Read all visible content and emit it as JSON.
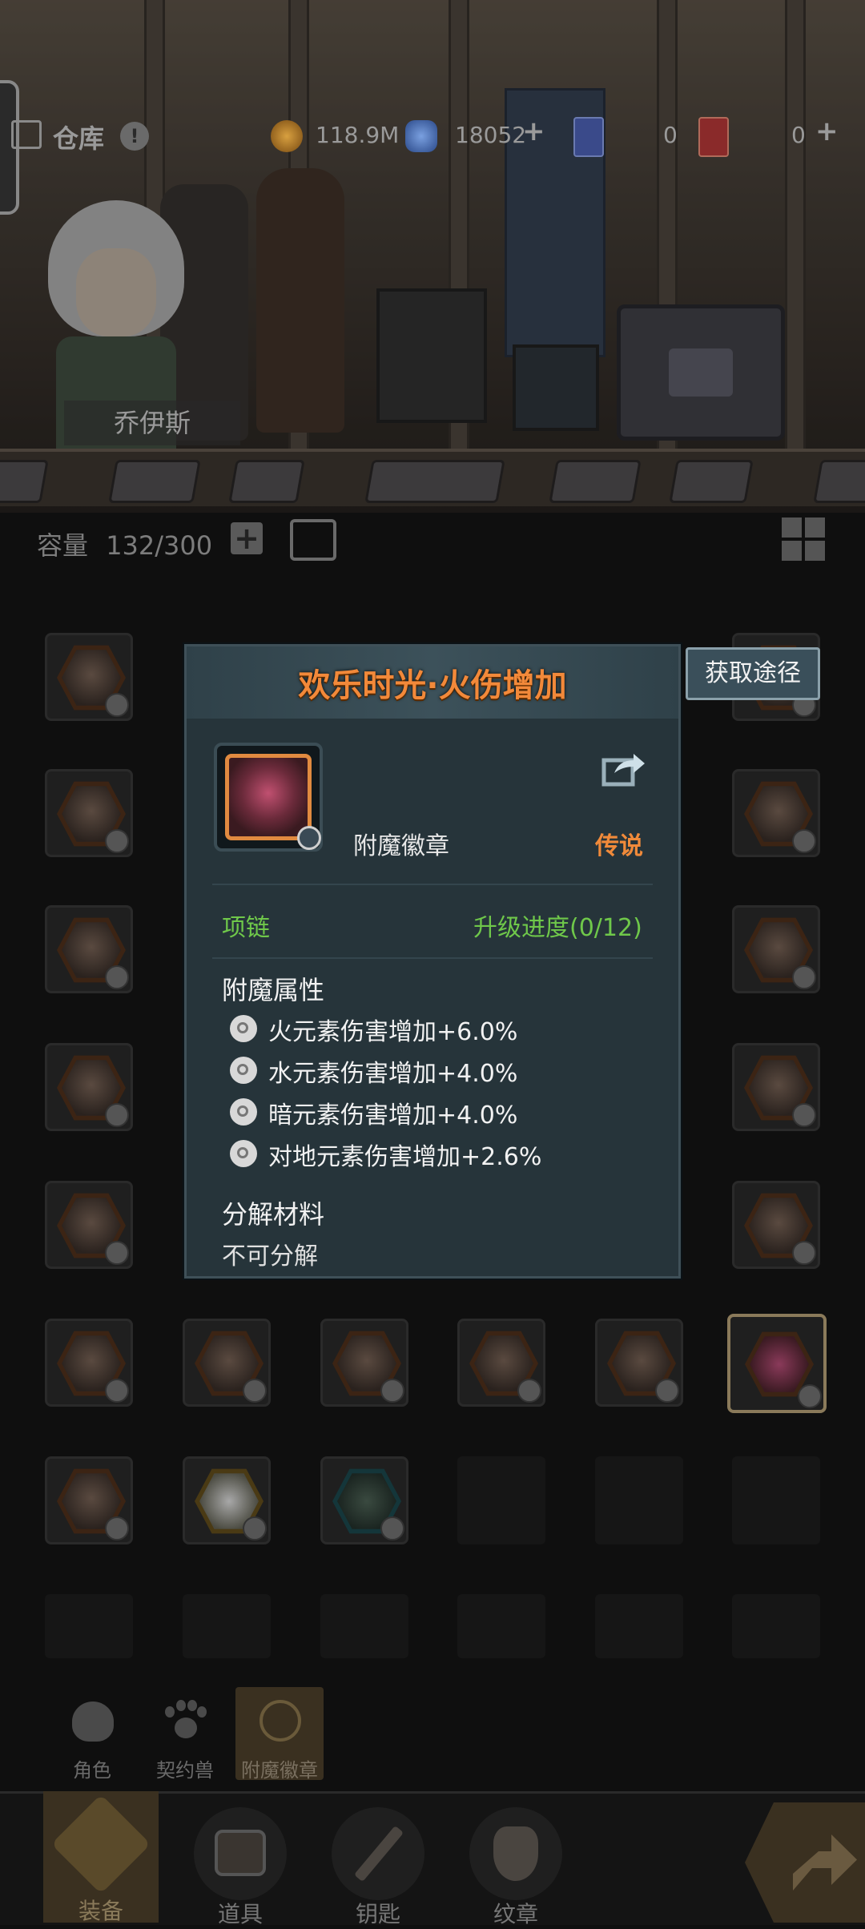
{
  "header": {
    "warehouse_label": "仓库",
    "character_name": "乔伊斯",
    "resources": [
      {
        "icon": "gold-coin-icon",
        "value": "118.9M"
      },
      {
        "icon": "blue-crystal-icon",
        "value": "18052"
      },
      {
        "icon": "blue-card-icon",
        "value": "0"
      },
      {
        "icon": "red-card-icon",
        "value": "0"
      }
    ]
  },
  "inventory": {
    "capacity_label": "容量",
    "capacity_value": "132/300"
  },
  "popup": {
    "title": "欢乐时光·火伤增加",
    "item_type": "附魔徽章",
    "rarity": "传说",
    "slot": "项链",
    "upgrade_progress": "升级进度(0/12)",
    "attributes_title": "附魔属性",
    "attributes": [
      "火元素伤害增加+6.0%",
      "水元素伤害增加+4.0%",
      "暗元素伤害增加+4.0%",
      "对地元素伤害增加+2.6%"
    ],
    "decompose_title": "分解材料",
    "decompose_value": "不可分解",
    "source_button": "获取途径"
  },
  "category_tabs": [
    {
      "label": "角色",
      "icon": "character-head-icon"
    },
    {
      "label": "契约兽",
      "icon": "paw-icon"
    },
    {
      "label": "附魔徽章",
      "icon": "enchant-badge-icon"
    }
  ],
  "bottom_nav": [
    {
      "label": "装备",
      "icon": "equipment-icon"
    },
    {
      "label": "道具",
      "icon": "chest-icon"
    },
    {
      "label": "钥匙",
      "icon": "key-icon"
    },
    {
      "label": "纹章",
      "icon": "crest-icon"
    }
  ],
  "colors": {
    "title_orange": "#f2893a",
    "rarity_orange": "#f08a3a",
    "green": "#6fc84a",
    "popup_bg": "#26343a"
  }
}
